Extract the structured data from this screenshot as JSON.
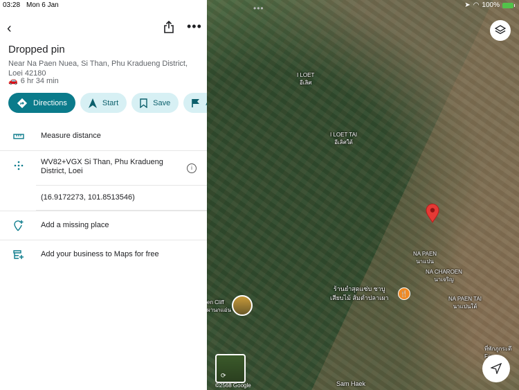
{
  "status": {
    "time": "03:28",
    "date": "Mon 6 Jan",
    "battery": "100%"
  },
  "place": {
    "title": "Dropped pin",
    "address": "Near Na Paen Nuea, Si Than, Phu Kradueng District, Loei 42180",
    "travel_time": "6 hr 34 min"
  },
  "actions": [
    {
      "label": "Directions",
      "icon": "directions-icon"
    },
    {
      "label": "Start",
      "icon": "navigation-arrow-icon"
    },
    {
      "label": "Save",
      "icon": "bookmark-icon"
    },
    {
      "label": "Ad",
      "icon": "flag-icon"
    }
  ],
  "list": {
    "measure": "Measure distance",
    "plus_code": "WV82+VGX Si Than, Phu Kradueng District, Loei",
    "coordinates": "(16.9172273, 101.8513546)",
    "add_place": "Add a missing place",
    "add_business": "Add your business to Maps for free"
  },
  "map": {
    "labels": {
      "i_loet_en": "I LOET",
      "i_loet_th": "อีเลิศ",
      "i_loet_tai_en": "I LOET TAI",
      "i_loet_tai_th": "อีเลิศใต้",
      "na_paen_en": "NA PAEN",
      "na_paen_th": "นาแปน",
      "na_charoen_en": "NA CHAROEN",
      "na_charoen_th": "นาเจริญ",
      "na_paen_tai_en": "NA PAEN TAI",
      "na_paen_tai_th": "นาแปนใต้",
      "restaurant_line1": "ร้านยำสุดแซ่บ ชาบู",
      "restaurant_line2": "เสียบไม้ ส้มตำปลาเผา",
      "cliff_line1": "en Cliff",
      "cliff_line2": "ผานกแอ่น",
      "sam_haek": "Sam Haek",
      "bottom_right_line1": "ที่พักภูกระดึ",
      "bottom_right_line2": "Far",
      "copyright": "©2568 Google"
    }
  }
}
